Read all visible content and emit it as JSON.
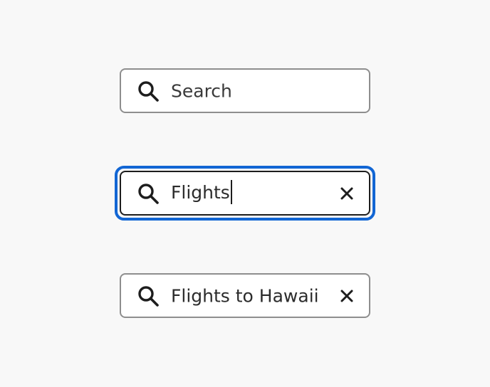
{
  "search_fields": [
    {
      "state": "placeholder",
      "value": "",
      "placeholder": "Search",
      "show_clear": false
    },
    {
      "state": "focused",
      "value": "Flights",
      "placeholder": "",
      "show_clear": true
    },
    {
      "state": "filled",
      "value": "Flights to Hawaii",
      "placeholder": "",
      "show_clear": true
    }
  ],
  "colors": {
    "background": "#f8f8f8",
    "field_border": "#8e8e8e",
    "focus_ring": "#1266d4",
    "text": "#2c2c2c"
  },
  "icons": {
    "search": "search-icon",
    "clear": "clear-icon"
  }
}
